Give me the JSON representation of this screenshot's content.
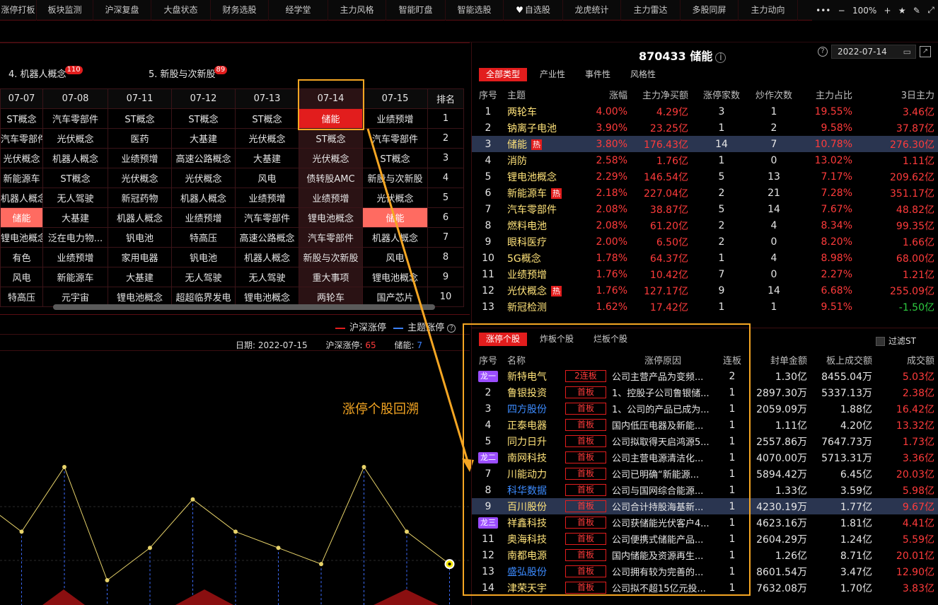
{
  "nav": {
    "items": [
      "涨停打板",
      "板块监测",
      "沪深复盘",
      "大盘状态",
      "财务选股",
      "经学堂",
      "主力风格",
      "智能盯盘",
      "智能选股",
      "自选股",
      "龙虎统计",
      "主力雷达",
      "多股同屏",
      "主力动向"
    ],
    "more": "•••",
    "zoom_minus": "−",
    "zoom": "100%",
    "zoom_plus": "+"
  },
  "left": {
    "concepts": [
      {
        "label": "4. 机器人概念",
        "count": "110"
      },
      {
        "label": "5. 新股与次新股",
        "count": "89"
      }
    ],
    "grid": {
      "headers": [
        "07-07",
        "07-08",
        "07-11",
        "07-12",
        "07-13",
        "07-14",
        "07-15",
        "排名"
      ],
      "rows": [
        [
          "ST概念",
          "汽车零部件",
          "ST概念",
          "ST概念",
          "ST概念",
          "储能",
          "业绩预增",
          "1"
        ],
        [
          "汽车零部件",
          "光伏概念",
          "医药",
          "大基建",
          "光伏概念",
          "ST概念",
          "汽车零部件",
          "2"
        ],
        [
          "光伏概念",
          "机器人概念",
          "业绩预增",
          "高速公路概念",
          "大基建",
          "光伏概念",
          "ST概念",
          "3"
        ],
        [
          "新能源车",
          "ST概念",
          "光伏概念",
          "光伏概念",
          "风电",
          "债转股AMC",
          "新股与次新股",
          "4"
        ],
        [
          "机器人概念",
          "无人驾驶",
          "新冠药物",
          "机器人概念",
          "业绩预增",
          "业绩预增",
          "光伏概念",
          "5"
        ],
        [
          "储能",
          "大基建",
          "机器人概念",
          "业绩预增",
          "汽车零部件",
          "锂电池概念",
          "储能",
          "6"
        ],
        [
          "锂电池概念",
          "泛在电力物...",
          "钒电池",
          "特高压",
          "高速公路概念",
          "汽车零部件",
          "机器人概念",
          "7"
        ],
        [
          "有色",
          "业绩预增",
          "家用电器",
          "钒电池",
          "机器人概念",
          "新股与次新股",
          "风电",
          "8"
        ],
        [
          "风电",
          "新能源车",
          "大基建",
          "无人驾驶",
          "无人驾驶",
          "重大事项",
          "锂电池概念",
          "9"
        ],
        [
          "特高压",
          "元宇宙",
          "锂电池概念",
          "超超临界发电",
          "锂电池概念",
          "两轮车",
          "国产芯片",
          "10"
        ]
      ]
    },
    "legend": {
      "a": "沪深涨停",
      "b": "主题涨停"
    },
    "info": {
      "date_label": "日期:",
      "date": "2022-07-15",
      "hs_label": "沪深涨停:",
      "hs_value": "65",
      "cn_label": "储能:",
      "cn_value": "7"
    },
    "annotation": "涨停个股回溯",
    "chart_data": {
      "type": "line",
      "series": [
        {
          "values": [
            7,
            5,
            9,
            2,
            4,
            7,
            5,
            4,
            3,
            9,
            5,
            3
          ]
        }
      ]
    }
  },
  "stock": {
    "title": "870433 储能",
    "info_icon": "i",
    "help_icon": "?",
    "date": "2022-07-14",
    "calendar_icon": "▭",
    "open_icon": "↗"
  },
  "theme_tabs": [
    "全部类型",
    "产业性",
    "事件性",
    "风格性"
  ],
  "theme_table": {
    "headers": [
      "序号",
      "主题",
      "涨幅",
      "主力净买额",
      "涨停家数",
      "炒作次数",
      "主力占比",
      "3日主力"
    ],
    "hot_label": "热",
    "rows": [
      {
        "no": "1",
        "name": "两轮车",
        "chg": "4.00%",
        "net": "4.29亿",
        "lim": "3",
        "times": "1",
        "ratio": "19.55%",
        "d3": "3.46亿",
        "hot": false
      },
      {
        "no": "2",
        "name": "钠离子电池",
        "chg": "3.90%",
        "net": "23.25亿",
        "lim": "1",
        "times": "2",
        "ratio": "9.58%",
        "d3": "37.87亿",
        "hot": false
      },
      {
        "no": "3",
        "name": "储能",
        "chg": "3.80%",
        "net": "176.43亿",
        "lim": "14",
        "times": "7",
        "ratio": "10.78%",
        "d3": "276.30亿",
        "hot": true
      },
      {
        "no": "4",
        "name": "消防",
        "chg": "2.58%",
        "net": "1.76亿",
        "lim": "1",
        "times": "0",
        "ratio": "13.02%",
        "d3": "1.11亿",
        "hot": false
      },
      {
        "no": "5",
        "name": "锂电池概念",
        "chg": "2.29%",
        "net": "146.54亿",
        "lim": "5",
        "times": "13",
        "ratio": "7.17%",
        "d3": "209.62亿",
        "hot": false
      },
      {
        "no": "6",
        "name": "新能源车",
        "chg": "2.18%",
        "net": "227.04亿",
        "lim": "2",
        "times": "21",
        "ratio": "7.28%",
        "d3": "351.17亿",
        "hot": true
      },
      {
        "no": "7",
        "name": "汽车零部件",
        "chg": "2.08%",
        "net": "38.87亿",
        "lim": "5",
        "times": "14",
        "ratio": "7.67%",
        "d3": "48.82亿",
        "hot": false
      },
      {
        "no": "8",
        "name": "燃料电池",
        "chg": "2.08%",
        "net": "61.20亿",
        "lim": "2",
        "times": "4",
        "ratio": "8.34%",
        "d3": "99.35亿",
        "hot": false
      },
      {
        "no": "9",
        "name": "眼科医疗",
        "chg": "2.00%",
        "net": "6.50亿",
        "lim": "2",
        "times": "0",
        "ratio": "8.20%",
        "d3": "1.66亿",
        "hot": false
      },
      {
        "no": "10",
        "name": "5G概念",
        "chg": "1.78%",
        "net": "64.37亿",
        "lim": "1",
        "times": "4",
        "ratio": "8.98%",
        "d3": "68.00亿",
        "hot": false
      },
      {
        "no": "11",
        "name": "业绩预增",
        "chg": "1.76%",
        "net": "10.42亿",
        "lim": "7",
        "times": "0",
        "ratio": "2.27%",
        "d3": "1.21亿",
        "hot": false
      },
      {
        "no": "12",
        "name": "光伏概念",
        "chg": "1.76%",
        "net": "127.17亿",
        "lim": "9",
        "times": "14",
        "ratio": "6.68%",
        "d3": "255.09亿",
        "hot": true
      },
      {
        "no": "13",
        "name": "新冠检测",
        "chg": "1.62%",
        "net": "17.42亿",
        "lim": "1",
        "times": "1",
        "ratio": "9.51%",
        "d3": "-1.50亿",
        "hot": false
      }
    ]
  },
  "limit_tabs": [
    "涨停个股",
    "炸板个股",
    "烂板个股"
  ],
  "filter_st": "过滤ST",
  "limit_table": {
    "headers": [
      "序号",
      "名称",
      "涨停原因",
      "连板",
      "封单金额",
      "板上成交额",
      "成交额"
    ],
    "rows": [
      {
        "no": "",
        "dragon": "龙一",
        "name": "新特电气",
        "color": "yel",
        "board": "2连板",
        "reason": "公司主营产品为变频...",
        "lb": "2",
        "seal": "1.30亿",
        "bvol": "8455.04万",
        "vol": "5.03亿"
      },
      {
        "no": "2",
        "dragon": "",
        "name": "鲁银投资",
        "color": "yel",
        "board": "首板",
        "reason": "1、控股子公司鲁银储...",
        "lb": "1",
        "seal": "2897.30万",
        "bvol": "5337.13万",
        "vol": "2.38亿"
      },
      {
        "no": "3",
        "dragon": "",
        "name": "四方股份",
        "color": "blu",
        "board": "首板",
        "reason": "1、公司的产品已成为...",
        "lb": "1",
        "seal": "2059.09万",
        "bvol": "1.88亿",
        "vol": "16.42亿"
      },
      {
        "no": "4",
        "dragon": "",
        "name": "正泰电器",
        "color": "yel",
        "board": "首板",
        "reason": "国内低压电器及新能...",
        "lb": "1",
        "seal": "1.11亿",
        "bvol": "4.20亿",
        "vol": "13.32亿"
      },
      {
        "no": "5",
        "dragon": "",
        "name": "同力日升",
        "color": "yel",
        "board": "首板",
        "reason": "公司拟取得天启鸿源5...",
        "lb": "1",
        "seal": "2557.86万",
        "bvol": "7647.73万",
        "vol": "1.73亿"
      },
      {
        "no": "",
        "dragon": "龙二",
        "name": "南网科技",
        "color": "yel",
        "board": "首板",
        "reason": "公司主营电源清洁化...",
        "lb": "1",
        "seal": "4070.00万",
        "bvol": "5713.31万",
        "vol": "3.36亿"
      },
      {
        "no": "7",
        "dragon": "",
        "name": "川能动力",
        "color": "yel",
        "board": "首板",
        "reason": "公司已明确“新能源...",
        "lb": "1",
        "seal": "5894.42万",
        "bvol": "6.45亿",
        "vol": "20.03亿"
      },
      {
        "no": "8",
        "dragon": "",
        "name": "科华数据",
        "color": "blu",
        "board": "首板",
        "reason": "公司与国网综合能源...",
        "lb": "1",
        "seal": "1.33亿",
        "bvol": "3.59亿",
        "vol": "5.98亿"
      },
      {
        "no": "9",
        "dragon": "",
        "name": "百川股份",
        "color": "yel",
        "board": "首板",
        "reason": "公司合计持股海基新...",
        "lb": "1",
        "seal": "4230.19万",
        "bvol": "1.77亿",
        "vol": "9.67亿"
      },
      {
        "no": "",
        "dragon": "龙三",
        "name": "祥鑫科技",
        "color": "yel",
        "board": "首板",
        "reason": "公司获储能光伏客户4...",
        "lb": "1",
        "seal": "4623.16万",
        "bvol": "1.81亿",
        "vol": "4.41亿"
      },
      {
        "no": "11",
        "dragon": "",
        "name": "奥海科技",
        "color": "yel",
        "board": "首板",
        "reason": "公司便携式储能产品...",
        "lb": "1",
        "seal": "2604.29万",
        "bvol": "1.24亿",
        "vol": "5.59亿"
      },
      {
        "no": "12",
        "dragon": "",
        "name": "南都电源",
        "color": "yel",
        "board": "首板",
        "reason": "国内储能及资源再生...",
        "lb": "1",
        "seal": "1.26亿",
        "bvol": "8.71亿",
        "vol": "20.01亿"
      },
      {
        "no": "13",
        "dragon": "",
        "name": "盛弘股份",
        "color": "blu",
        "board": "首板",
        "reason": "公司拥有较为完善的...",
        "lb": "1",
        "seal": "8601.54万",
        "bvol": "3.47亿",
        "vol": "12.90亿"
      },
      {
        "no": "14",
        "dragon": "",
        "name": "津荣天宇",
        "color": "yel",
        "board": "首板",
        "reason": "公司拟不超15亿元投...",
        "lb": "1",
        "seal": "7632.08万",
        "bvol": "1.70亿",
        "vol": "3.83亿"
      }
    ]
  },
  "colors": {
    "accent": "#e21d1d",
    "highlight": "#f5a623",
    "rise": "#ff3b3b",
    "fall": "#2ecc40",
    "select": "#2a3550"
  }
}
